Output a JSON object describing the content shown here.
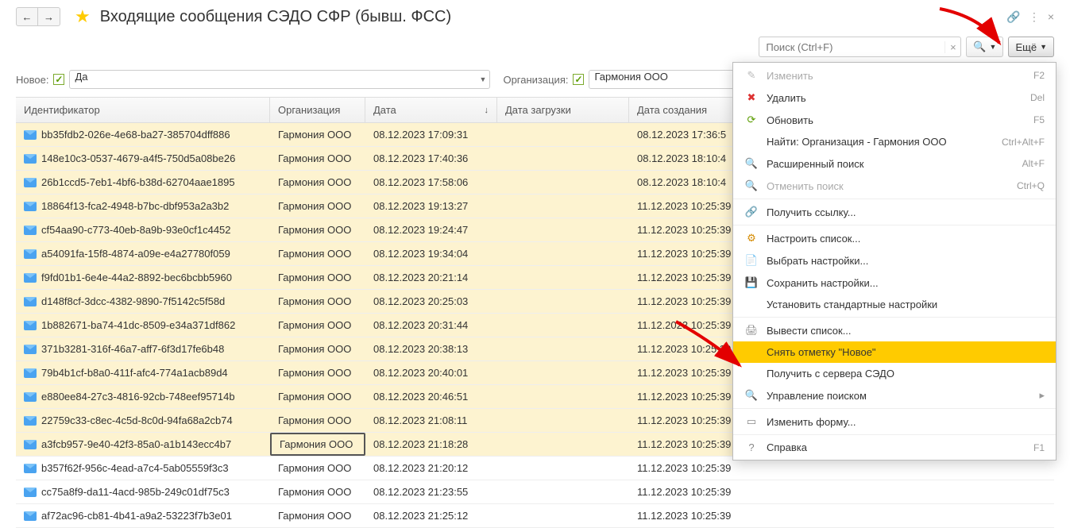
{
  "title": "Входящие сообщения СЭДО СФР (бывш. ФСС)",
  "search": {
    "placeholder": "Поиск (Ctrl+F)",
    "clear": "×"
  },
  "more_btn": "Ещё",
  "filters": {
    "novoe_label": "Новое:",
    "novoe_value": "Да",
    "org_label": "Организация:",
    "org_value": "Гармония ООО"
  },
  "columns": {
    "id": "Идентификатор",
    "org": "Организация",
    "date": "Дата",
    "dz": "Дата загрузки",
    "dc": "Дата создания"
  },
  "rows": [
    {
      "id": "bb35fdb2-026e-4e68-ba27-385704dff886",
      "org": "Гармония ООО",
      "date": "08.12.2023 17:09:31",
      "dz": "",
      "dc": "08.12.2023 17:36:5",
      "new": true
    },
    {
      "id": "148e10c3-0537-4679-a4f5-750d5a08be26",
      "org": "Гармония ООО",
      "date": "08.12.2023 17:40:36",
      "dz": "",
      "dc": "08.12.2023 18:10:4",
      "new": true
    },
    {
      "id": "26b1ccd5-7eb1-4bf6-b38d-62704aae1895",
      "org": "Гармония ООО",
      "date": "08.12.2023 17:58:06",
      "dz": "",
      "dc": "08.12.2023 18:10:4",
      "new": true
    },
    {
      "id": "18864f13-fca2-4948-b7bc-dbf953a2a3b2",
      "org": "Гармония ООО",
      "date": "08.12.2023 19:13:27",
      "dz": "",
      "dc": "11.12.2023 10:25:39",
      "new": true
    },
    {
      "id": "cf54aa90-c773-40eb-8a9b-93e0cf1c4452",
      "org": "Гармония ООО",
      "date": "08.12.2023 19:24:47",
      "dz": "",
      "dc": "11.12.2023 10:25:39",
      "new": true
    },
    {
      "id": "a54091fa-15f8-4874-a09e-e4a27780f059",
      "org": "Гармония ООО",
      "date": "08.12.2023 19:34:04",
      "dz": "",
      "dc": "11.12.2023 10:25:39",
      "new": true
    },
    {
      "id": "f9fd01b1-6e4e-44a2-8892-bec6bcbb5960",
      "org": "Гармония ООО",
      "date": "08.12.2023 20:21:14",
      "dz": "",
      "dc": "11.12.2023 10:25:39",
      "new": true
    },
    {
      "id": "d148f8cf-3dcc-4382-9890-7f5142c5f58d",
      "org": "Гармония ООО",
      "date": "08.12.2023 20:25:03",
      "dz": "",
      "dc": "11.12.2023 10:25:39",
      "new": true
    },
    {
      "id": "1b882671-ba74-41dc-8509-e34a371df862",
      "org": "Гармония ООО",
      "date": "08.12.2023 20:31:44",
      "dz": "",
      "dc": "11.12.2023 10:25:39",
      "new": true
    },
    {
      "id": "371b3281-316f-46a7-aff7-6f3d17fe6b48",
      "org": "Гармония ООО",
      "date": "08.12.2023 20:38:13",
      "dz": "",
      "dc": "11.12.2023 10:25:39",
      "new": true
    },
    {
      "id": "79b4b1cf-b8a0-411f-afc4-774a1acb89d4",
      "org": "Гармония ООО",
      "date": "08.12.2023 20:40:01",
      "dz": "",
      "dc": "11.12.2023 10:25:39",
      "new": true
    },
    {
      "id": "e880ee84-27c3-4816-92cb-748eef95714b",
      "org": "Гармония ООО",
      "date": "08.12.2023 20:46:51",
      "dz": "",
      "dc": "11.12.2023 10:25:39",
      "new": true
    },
    {
      "id": "22759c33-c8ec-4c5d-8c0d-94fa68a2cb74",
      "org": "Гармония ООО",
      "date": "08.12.2023 21:08:11",
      "dz": "",
      "dc": "11.12.2023 10:25:39",
      "new": true
    },
    {
      "id": "a3fcb957-9e40-42f3-85a0-a1b143ecc4b7",
      "org": "Гармония ООО",
      "date": "08.12.2023 21:18:28",
      "dz": "",
      "dc": "11.12.2023 10:25:39",
      "new": true,
      "sel": true
    },
    {
      "id": "b357f62f-956c-4ead-a7c4-5ab05559f3c3",
      "org": "Гармония ООО",
      "date": "08.12.2023 21:20:12",
      "dz": "",
      "dc": "11.12.2023 10:25:39",
      "new": false
    },
    {
      "id": "cc75a8f9-da11-4acd-985b-249c01df75c3",
      "org": "Гармония ООО",
      "date": "08.12.2023 21:23:55",
      "dz": "",
      "dc": "11.12.2023 10:25:39",
      "new": false
    },
    {
      "id": "af72ac96-cb81-4b41-a9a2-53223f7b3e01",
      "org": "Гармония ООО",
      "date": "08.12.2023 21:25:12",
      "dz": "",
      "dc": "11.12.2023 10:25:39",
      "new": false
    }
  ],
  "menu": [
    {
      "icon": "pencil",
      "label": "Изменить",
      "short": "F2",
      "disabled": true
    },
    {
      "icon": "del",
      "label": "Удалить",
      "short": "Del"
    },
    {
      "icon": "refresh",
      "label": "Обновить",
      "short": "F5"
    },
    {
      "icon": "",
      "label": "Найти: Организация - Гармония ООО",
      "short": "Ctrl+Alt+F"
    },
    {
      "icon": "search",
      "label": "Расширенный поиск",
      "short": "Alt+F"
    },
    {
      "icon": "nosearch",
      "label": "Отменить поиск",
      "short": "Ctrl+Q",
      "disabled": true
    },
    {
      "sep": true
    },
    {
      "icon": "link",
      "label": "Получить ссылку...",
      "short": ""
    },
    {
      "sep": true
    },
    {
      "icon": "gear",
      "label": "Настроить список...",
      "short": ""
    },
    {
      "icon": "pick",
      "label": "Выбрать настройки...",
      "short": ""
    },
    {
      "icon": "save",
      "label": "Сохранить настройки...",
      "short": ""
    },
    {
      "icon": "",
      "label": "Установить стандартные настройки",
      "short": ""
    },
    {
      "sep": true
    },
    {
      "icon": "printer",
      "label": "Вывести список...",
      "short": ""
    },
    {
      "icon": "",
      "label": "Снять отметку \"Новое\"",
      "short": "",
      "hl": true
    },
    {
      "icon": "",
      "label": "Получить с сервера СЭДО",
      "short": ""
    },
    {
      "icon": "search",
      "label": "Управление поиском",
      "short": "",
      "sub": true
    },
    {
      "sep": true
    },
    {
      "icon": "form",
      "label": "Изменить форму...",
      "short": ""
    },
    {
      "sep": true
    },
    {
      "icon": "help",
      "label": "Справка",
      "short": "F1"
    }
  ]
}
